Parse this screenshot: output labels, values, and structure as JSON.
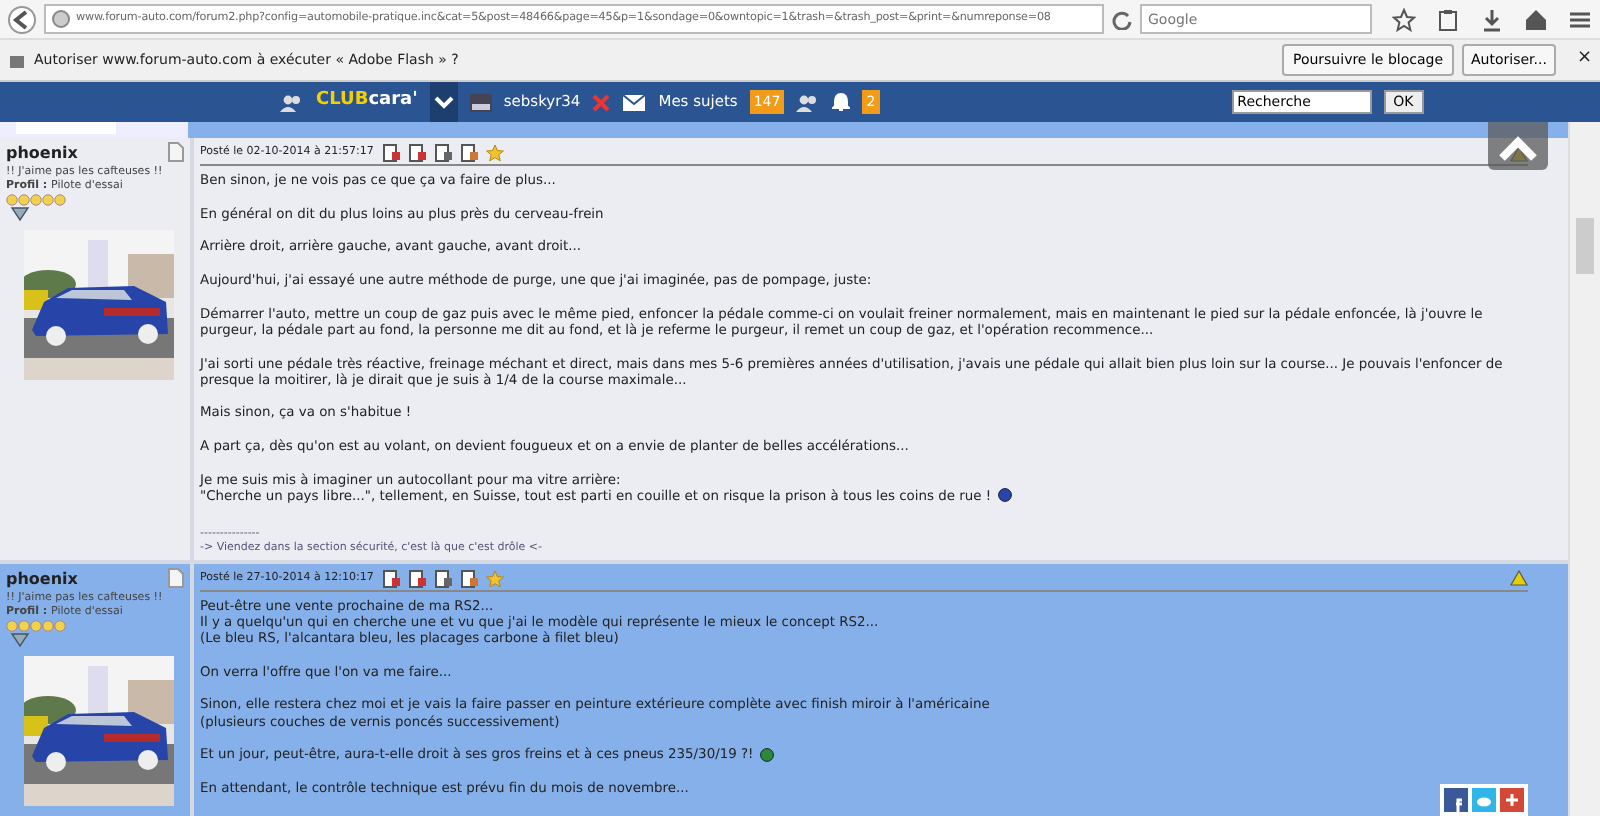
{
  "browser": {
    "url": "www.forum-auto.com/forum2.php?config=automobile-pratique.inc&cat=5&post=48466&page=45&p=1&sondage=0&owntopic=1&trash=&trash_post=&print=&numreponse=08",
    "search_placeholder": "Google"
  },
  "flash_bar": {
    "message": "Autoriser www.forum-auto.com à exécuter « Adobe Flash » ?",
    "buttons": [
      "Poursuivre le blocage",
      "Autoriser..."
    ],
    "close": "×"
  },
  "navbar": {
    "logo_club": "CLUB",
    "logo_cara": "cara'",
    "username": "sebskyr34",
    "topics_label": "Mes sujets",
    "topics_count": "147",
    "notifications_count": "2",
    "search_value": "Recherche",
    "search_button": "OK"
  },
  "posts": [
    {
      "author": "phoenix",
      "motto": "!! J'aime pas les cafteuses !!",
      "profile_label": "Profil :",
      "profile": "Pilote d'essai",
      "stars": 5,
      "date": "Posté le 02-10-2014 à 21:57:17",
      "highlighted": false,
      "paragraphs": [
        {
          "lines": [
            "Ben sinon, je ne vois pas ce que ça va faire de plus..."
          ],
          "emoticon": false
        },
        {
          "lines": [
            "En général on dit du plus loins au plus près du cerveau-frein"
          ],
          "emoticon": false
        },
        {
          "lines": [
            "Arrière droit, arrière gauche, avant gauche, avant droit..."
          ],
          "emoticon": false
        },
        {
          "lines": [
            "Aujourd'hui, j'ai essayé une autre méthode de purge, une que j'ai imaginée, pas de pompage, juste:"
          ],
          "emoticon": false
        },
        {
          "lines": [
            "Démarrer l'auto, mettre un coup de gaz puis avec le même pied, enfoncer la pédale comme-ci on voulait freiner normalement, mais en maintenant le pied sur la pédale enfoncée, là j'ouvre le purgeur, la pédale part au fond, la personne me dit au fond, et là je referme le purgeur, il remet un coup de gaz, et l'opération recommence..."
          ],
          "emoticon": false
        },
        {
          "lines": [
            "J'ai sorti une pédale très réactive, freinage méchant et direct, mais dans mes 5-6 premières années d'utilisation, j'avais une pédale qui allait bien plus loin sur la course... Je pouvais l'enfoncer de presque la moitirer, là je dirait que je suis à 1/4 de la course maximale..."
          ],
          "emoticon": false
        },
        {
          "lines": [
            "Mais sinon, ça va on s'habitue !"
          ],
          "emoticon": false
        },
        {
          "lines": [
            "A part ça, dès qu'on est au volant, on devient fougueux et on a envie de planter de belles accélérations..."
          ],
          "emoticon": false
        },
        {
          "lines": [
            "Je me suis mis à imaginer un autocollant pour ma vitre arrière:",
            "\"Cherche un pays libre...\", tellement, en Suisse, tout est parti en couille et on risque la prison à tous les coins de rue !"
          ],
          "emoticon": true
        }
      ],
      "signature_rule": "---------------",
      "signature": "-> Viendez dans la section sécurité, c'est là que c'est drôle <-"
    },
    {
      "author": "phoenix",
      "motto": "!! J'aime pas les cafteuses !!",
      "profile_label": "Profil :",
      "profile": "Pilote d'essai",
      "stars": 5,
      "date": "Posté le 27-10-2014 à 12:10:17",
      "highlighted": true,
      "paragraphs": [
        {
          "lines": [
            "Peut-être une vente prochaine de ma RS2...",
            "Il y a quelqu'un qui en cherche une et vu que j'ai le modèle qui représente le mieux le concept RS2...",
            "(Le bleu RS, l'alcantara bleu, les placages carbone à filet bleu)"
          ],
          "emoticon": false
        },
        {
          "lines": [
            "On verra l'offre que l'on va me faire..."
          ],
          "emoticon": false
        },
        {
          "lines": [
            "Sinon, elle restera chez moi et je vais la faire passer en peinture extérieure complète avec finish miroir à l'américaine",
            "(plusieurs couches de vernis poncés successivement)"
          ],
          "emoticon": false
        },
        {
          "lines": [
            "Et un jour, peut-être, aura-t-elle droit à ses gros freins et à ces pneus 235/30/19 ?!"
          ],
          "emoticon": true
        },
        {
          "lines": [
            "En attendant, le contrôle technique est prévu fin du mois de novembre..."
          ],
          "emoticon": false
        }
      ]
    }
  ]
}
